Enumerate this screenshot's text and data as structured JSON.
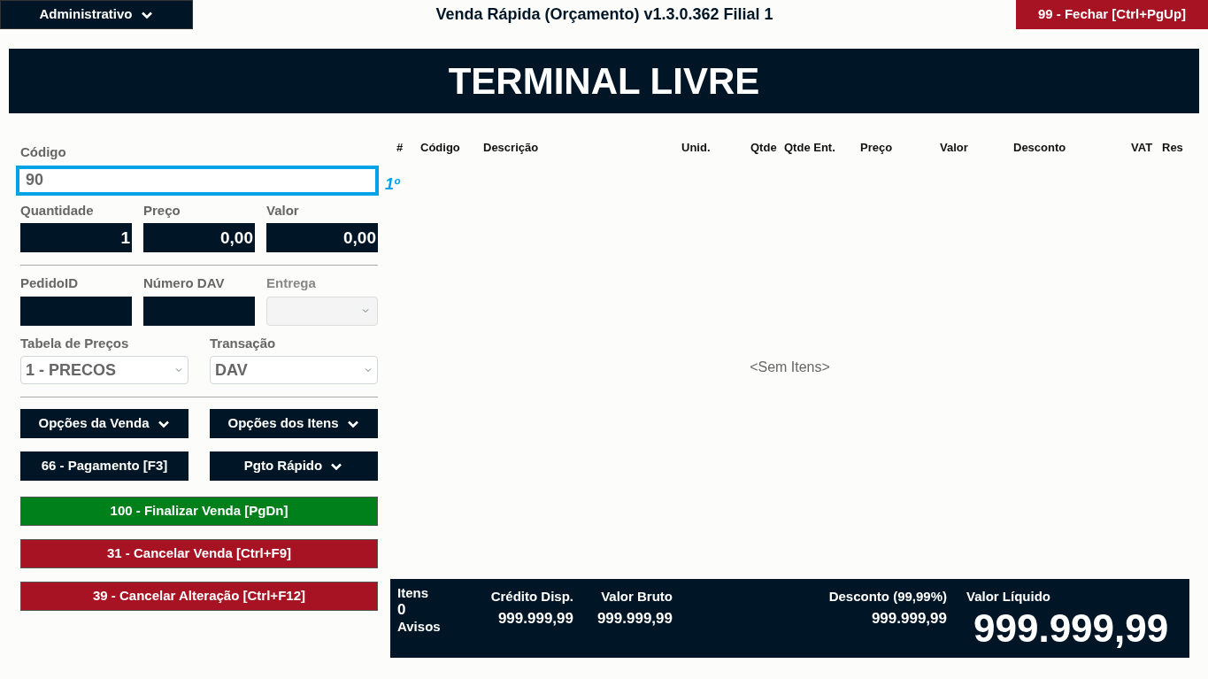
{
  "top_bar": {
    "menu": "Administrativo",
    "title": "Venda Rápida (Orçamento) v1.3.0.362 Filial 1",
    "close_button": "99 - Fechar [Ctrl+PgUp]"
  },
  "banner": "TERMINAL LIVRE",
  "code_field": {
    "label": "Código",
    "value": "90",
    "focused": true,
    "hint": "1º"
  },
  "amount_fields": [
    {
      "label": "Quantidade",
      "value": "1"
    },
    {
      "label": "Preço",
      "value": "0,00"
    },
    {
      "label": "Valor",
      "value": "0,00"
    }
  ],
  "order_fields": [
    {
      "label": "PedidoID",
      "kind": "input",
      "disabled": false
    },
    {
      "label": "Número DAV",
      "kind": "input",
      "disabled": false
    },
    {
      "label": "Entrega",
      "kind": "select",
      "disabled": true
    }
  ],
  "selects": [
    {
      "label": "Tabela de Preços",
      "value": "1 - PRECOS"
    },
    {
      "label": "Transação",
      "value": "DAV"
    }
  ],
  "menu_buttons": [
    {
      "label": "Opções da Venda",
      "dropdown": true
    },
    {
      "label": "Opções dos Itens",
      "dropdown": true
    },
    {
      "label": "66 - Pagamento [F3]",
      "dropdown": false
    },
    {
      "label": "Pgto Rápido",
      "dropdown": true
    }
  ],
  "action_buttons": [
    {
      "label": "100 - Finalizar Venda [PgDn]",
      "kind": "confirm"
    },
    {
      "label": "31 - Cancelar Venda [Ctrl+F9]",
      "kind": "danger"
    },
    {
      "label": "39 - Cancelar Alteração [Ctrl+F12]",
      "kind": "danger"
    }
  ],
  "table": {
    "columns": [
      "#",
      "Código",
      "Descrição",
      "Unid.",
      "Qtde",
      "Qtde Ent.",
      "Preço",
      "Valor",
      "Desconto",
      "VAT",
      "Res"
    ],
    "empty_text": "<Sem Itens>"
  },
  "summary": {
    "items_label": "Itens",
    "items_count": "0",
    "warnings_label": "Avisos",
    "credit_label": "Crédito Disp.",
    "credit_value": "999.999,99",
    "gross_label": "Valor Bruto",
    "gross_value": "999.999,99",
    "discount_label": "Desconto (99,99%)",
    "discount_value": "999.999,99",
    "net_label": "Valor Líquido",
    "net_value": "999.999,99"
  }
}
